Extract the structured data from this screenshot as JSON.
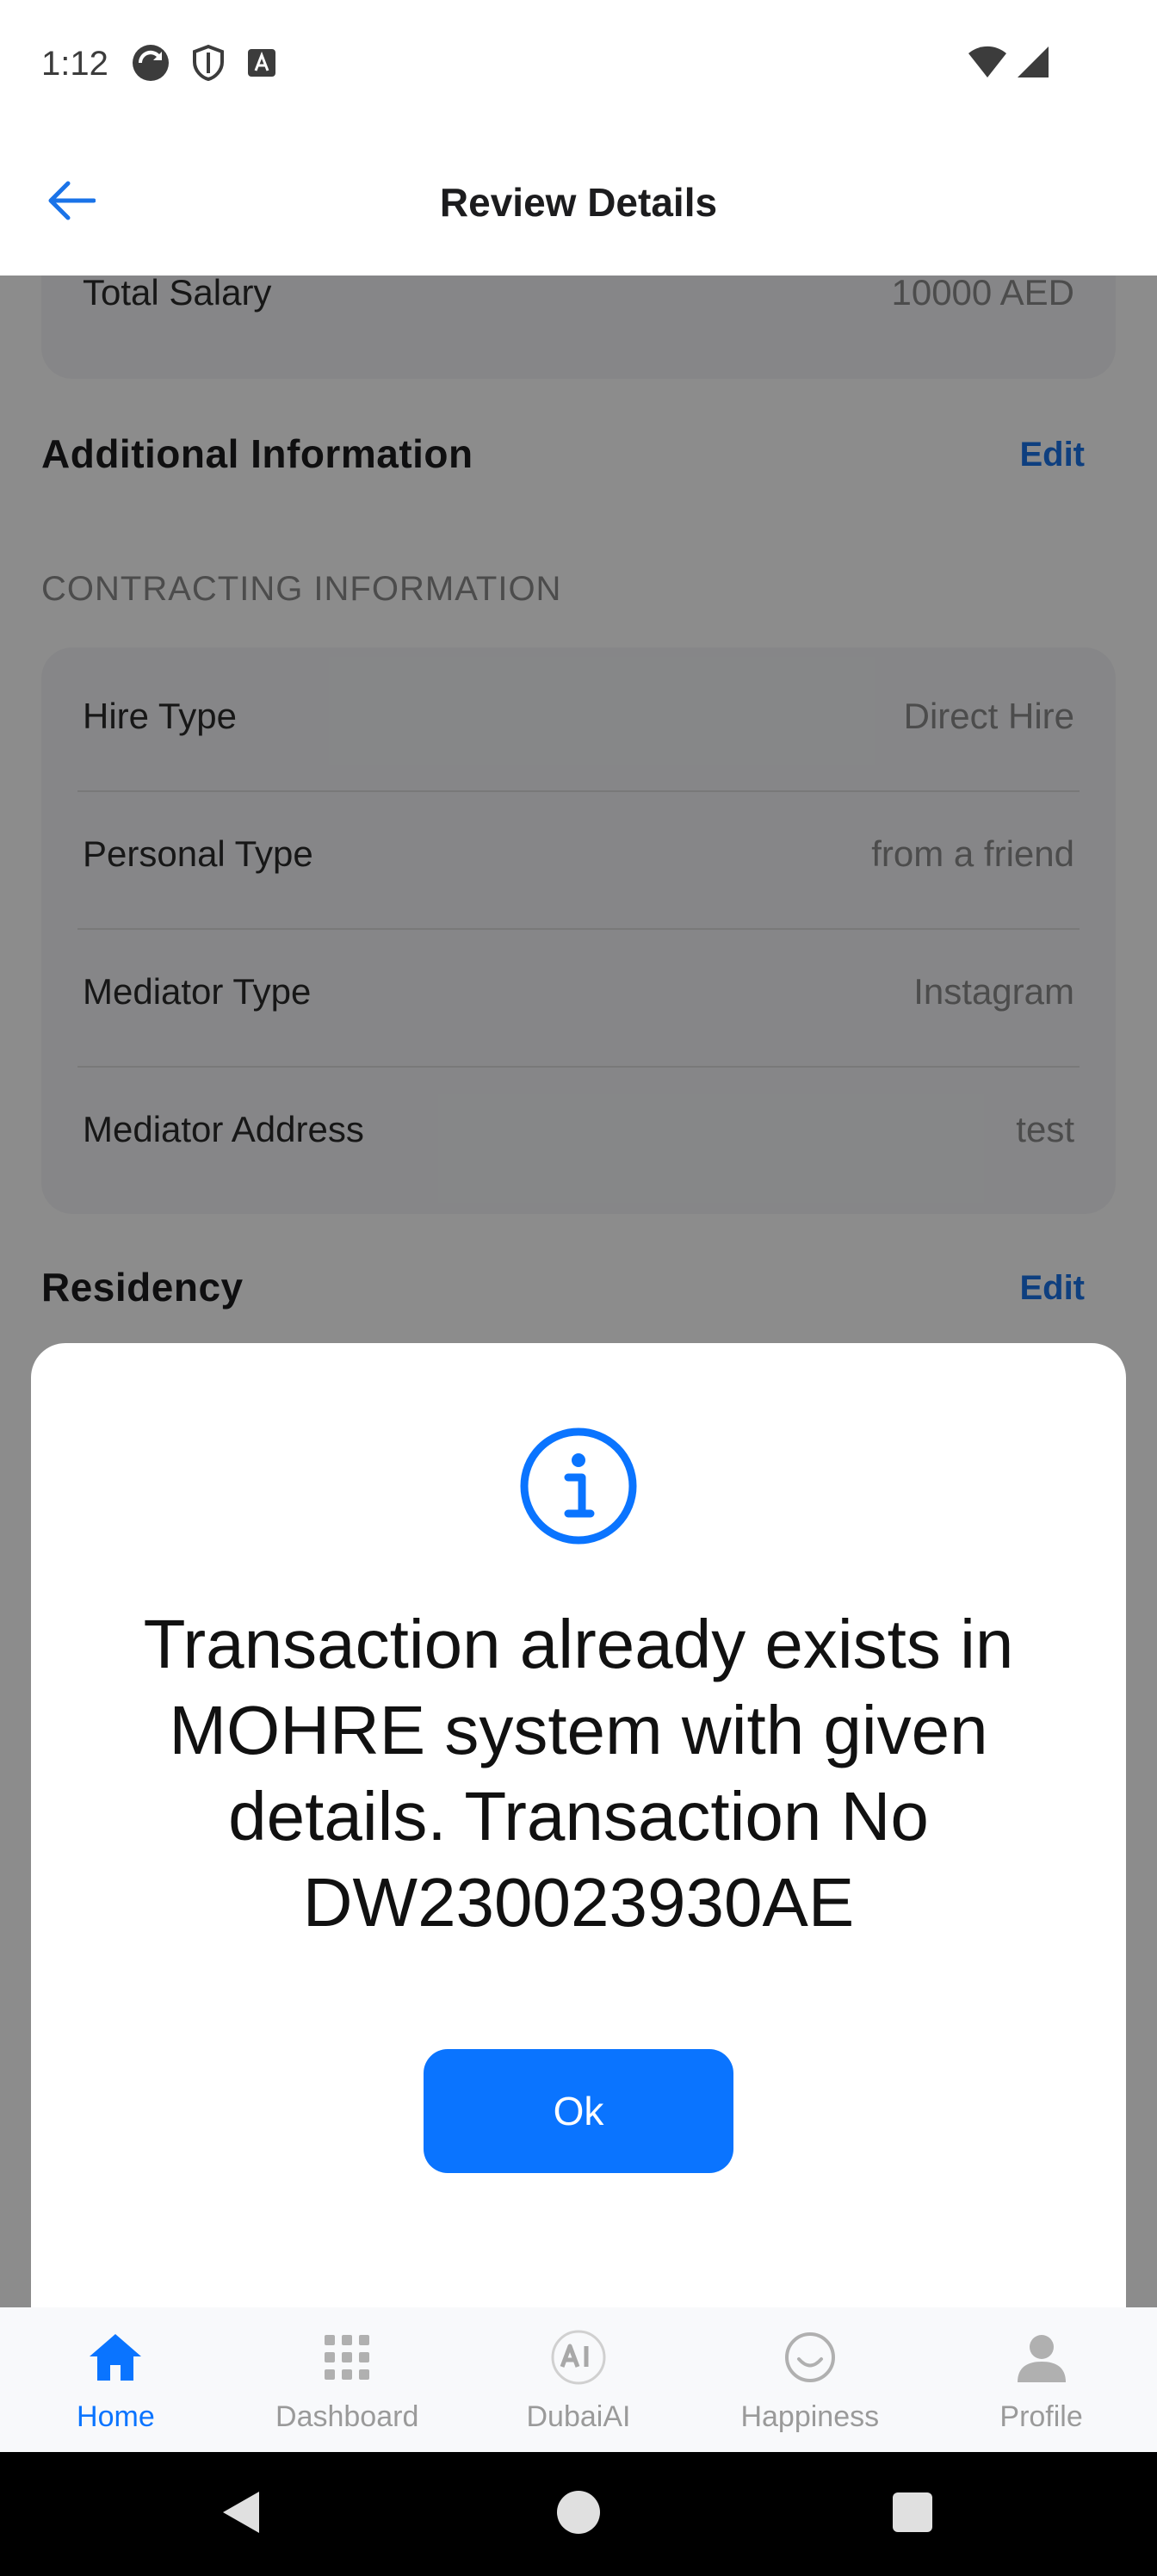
{
  "status_bar": {
    "time": "1:12"
  },
  "header": {
    "title": "Review Details"
  },
  "salary": {
    "label": "Total Salary",
    "value": "10000 AED"
  },
  "additional": {
    "title": "Additional Information",
    "edit_label": "Edit",
    "subsection": "CONTRACTING INFORMATION",
    "rows": [
      {
        "label": "Hire Type",
        "value": "Direct Hire"
      },
      {
        "label": "Personal Type",
        "value": "from a friend"
      },
      {
        "label": "Mediator Type",
        "value": "Instagram"
      },
      {
        "label": "Mediator Address",
        "value": "test"
      }
    ]
  },
  "residency": {
    "title": "Residency",
    "edit_label": "Edit"
  },
  "dialog": {
    "message": "Transaction already exists in MOHRE system with given details. Transaction No DW230023930AE",
    "ok_label": "Ok"
  },
  "bottom_nav": {
    "items": [
      {
        "label": "Home",
        "icon": "home-icon",
        "active": true
      },
      {
        "label": "Dashboard",
        "icon": "grid-icon",
        "active": false
      },
      {
        "label": "DubaiAI",
        "icon": "ai-icon",
        "active": false
      },
      {
        "label": "Happiness",
        "icon": "smiley-icon",
        "active": false
      },
      {
        "label": "Profile",
        "icon": "person-icon",
        "active": false
      }
    ]
  },
  "colors": {
    "accent": "#0a74ff",
    "edit": "#1a73e8",
    "scrim": "rgba(0,0,0,0.45)"
  }
}
